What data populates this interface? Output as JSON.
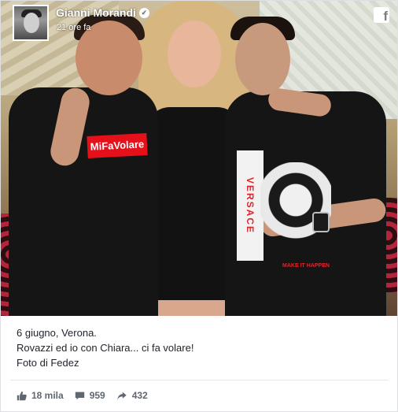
{
  "post": {
    "author": "Gianni Morandi",
    "time": "21 ore fa",
    "caption_lines": [
      "6 giugno, Verona.",
      "Rovazzi ed io con Chiara... ci fa volare!",
      "Foto di Fedez"
    ]
  },
  "photo": {
    "shirt_text": "MiFaVolare",
    "shirt_brand": "VERSACE",
    "shirt_slogan": "MAKE IT HAPPEN"
  },
  "stats": {
    "likes": "18 mila",
    "comments": "959",
    "shares": "432"
  },
  "icons": {
    "like": "thumbs-up-icon",
    "comment": "comment-icon",
    "share": "share-arrow-icon",
    "brand": "facebook-icon"
  },
  "colors": {
    "stat_gray": "#606770",
    "text": "#1d2129",
    "shirt_red": "#e5101a"
  }
}
